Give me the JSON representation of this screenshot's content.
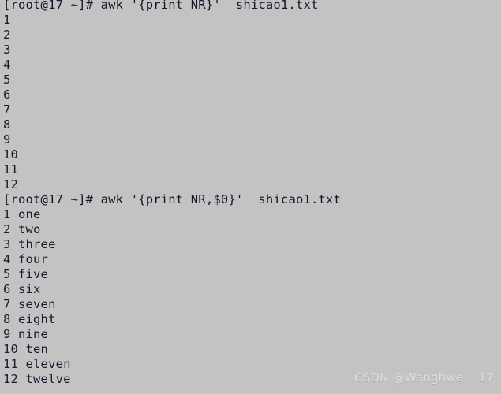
{
  "terminal": {
    "background_color": "#c3c3c3",
    "text_color": "#1a1a2e",
    "lines": [
      {
        "type": "prompt",
        "text": "[root@17 ~]# awk '{print NR}'  shicao1.txt"
      },
      {
        "type": "output",
        "text": "1"
      },
      {
        "type": "output",
        "text": "2"
      },
      {
        "type": "output",
        "text": "3"
      },
      {
        "type": "output",
        "text": "4"
      },
      {
        "type": "output",
        "text": "5"
      },
      {
        "type": "output",
        "text": "6"
      },
      {
        "type": "output",
        "text": "7"
      },
      {
        "type": "output",
        "text": "8"
      },
      {
        "type": "output",
        "text": "9"
      },
      {
        "type": "output",
        "text": "10"
      },
      {
        "type": "output",
        "text": "11"
      },
      {
        "type": "output",
        "text": "12"
      },
      {
        "type": "prompt",
        "text": "[root@17 ~]# awk '{print NR,$0}'  shicao1.txt"
      },
      {
        "type": "output",
        "text": "1 one"
      },
      {
        "type": "output",
        "text": "2 two"
      },
      {
        "type": "output",
        "text": "3 three"
      },
      {
        "type": "output",
        "text": "4 four"
      },
      {
        "type": "output",
        "text": "5 five"
      },
      {
        "type": "output",
        "text": "6 six"
      },
      {
        "type": "output",
        "text": "7 seven"
      },
      {
        "type": "output",
        "text": "8 eight"
      },
      {
        "type": "output",
        "text": "9 nine"
      },
      {
        "type": "output",
        "text": "10 ten"
      },
      {
        "type": "output",
        "text": "11 eleven"
      },
      {
        "type": "output",
        "text": "12 twelve"
      }
    ]
  },
  "watermark": {
    "text": "CSDN @Wanghwei   17",
    "color": "#dedede"
  }
}
